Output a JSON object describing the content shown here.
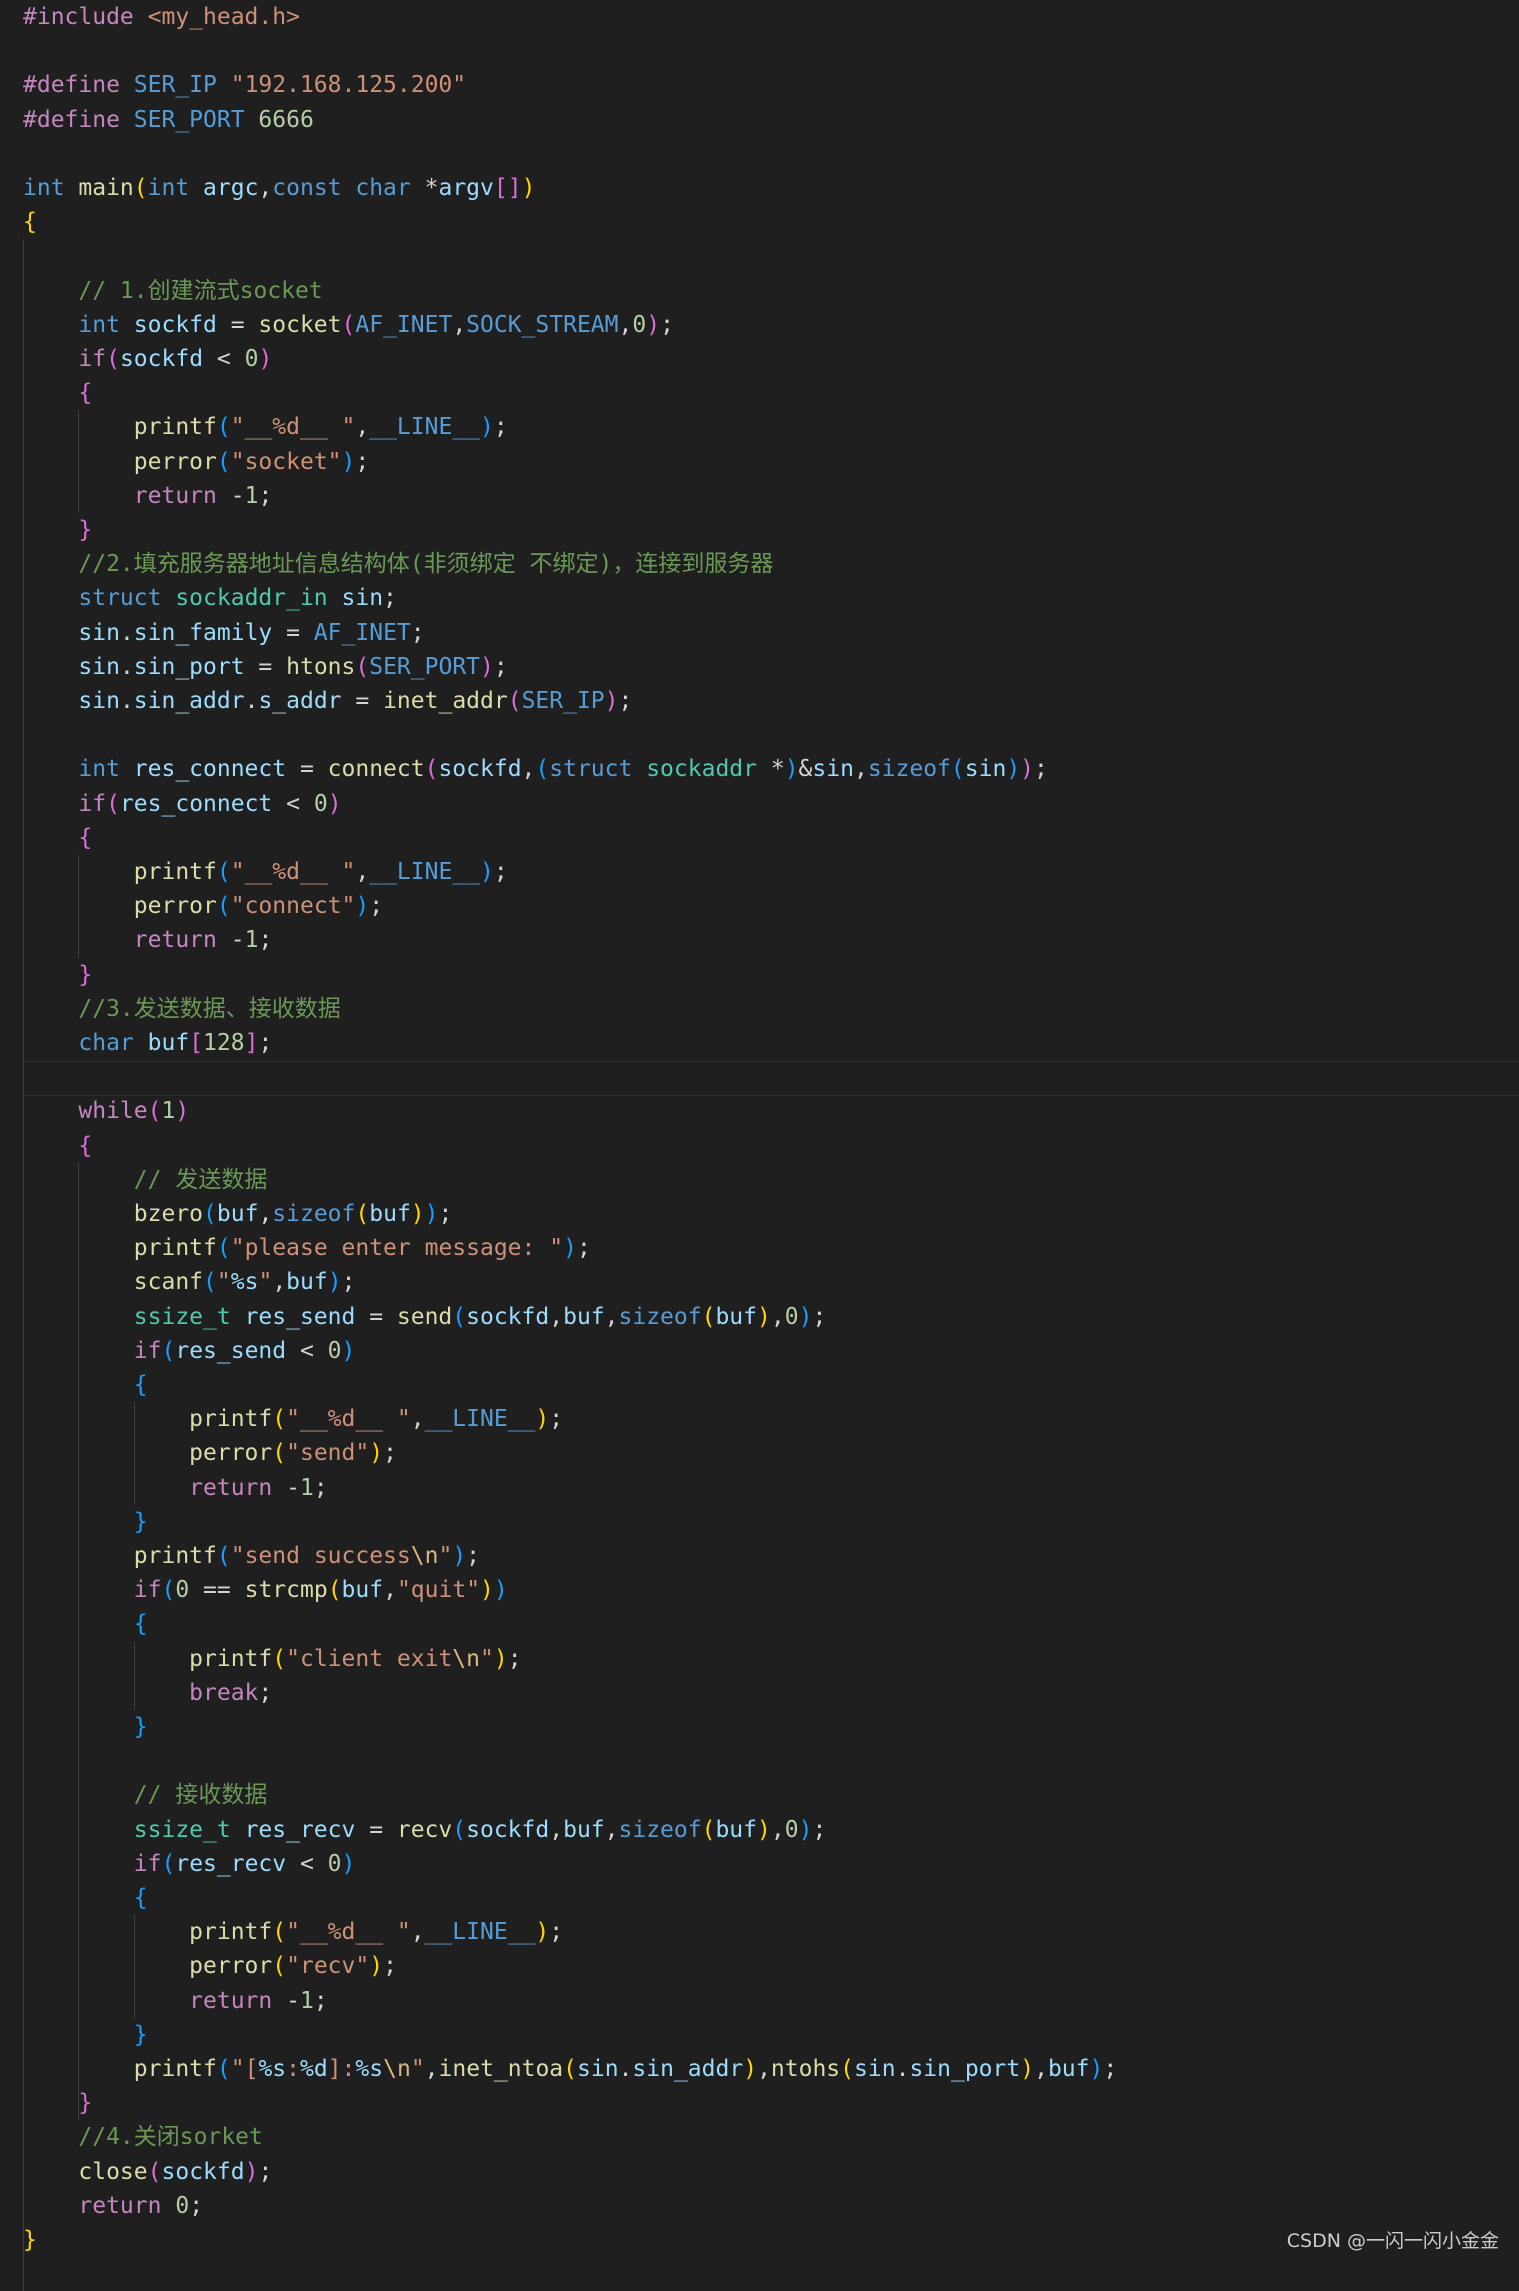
{
  "colors": {
    "background": "#1f1f1f",
    "keyword": "#569cd6",
    "control": "#c586c0",
    "function": "#dcdcaa",
    "variable": "#9cdcfe",
    "string": "#ce9178",
    "number": "#b5cea8",
    "comment": "#6a9955",
    "type": "#4ec9b0",
    "bracket_1": "#ffd700",
    "bracket_2": "#da70d6",
    "bracket_3": "#179fff"
  },
  "watermark": "CSDN @一闪一闪小金金",
  "code": [
    [
      [
        "pp",
        "#include "
      ],
      [
        "inc",
        "<my_head.h>"
      ]
    ],
    [],
    [
      [
        "pp",
        "#define "
      ],
      [
        "mac",
        "SER_IP "
      ],
      [
        "str",
        "\"192.168.125.200\""
      ]
    ],
    [
      [
        "pp",
        "#define "
      ],
      [
        "mac",
        "SER_PORT "
      ],
      [
        "num",
        "6666"
      ]
    ],
    [],
    [
      [
        "kw",
        "int "
      ],
      [
        "fn",
        "main"
      ],
      [
        "br1",
        "("
      ],
      [
        "kw",
        "int "
      ],
      [
        "var",
        "argc"
      ],
      [
        "txt",
        ","
      ],
      [
        "kw",
        "const char "
      ],
      [
        "txt",
        "*"
      ],
      [
        "var",
        "argv"
      ],
      [
        "br2",
        "[]"
      ],
      [
        "br1",
        ")"
      ]
    ],
    [
      [
        "br1",
        "{"
      ]
    ],
    [],
    [
      [
        "txt",
        "    "
      ],
      [
        "cmt",
        "// 1.创建流式socket"
      ]
    ],
    [
      [
        "txt",
        "    "
      ],
      [
        "kw",
        "int "
      ],
      [
        "var",
        "sockfd"
      ],
      [
        "txt",
        " = "
      ],
      [
        "fn",
        "socket"
      ],
      [
        "br2",
        "("
      ],
      [
        "mac",
        "AF_INET"
      ],
      [
        "txt",
        ","
      ],
      [
        "mac",
        "SOCK_STREAM"
      ],
      [
        "txt",
        ","
      ],
      [
        "num",
        "0"
      ],
      [
        "br2",
        ")"
      ],
      [
        "txt",
        ";"
      ]
    ],
    [
      [
        "txt",
        "    "
      ],
      [
        "ctl",
        "if"
      ],
      [
        "br2",
        "("
      ],
      [
        "var",
        "sockfd"
      ],
      [
        "txt",
        " < "
      ],
      [
        "num",
        "0"
      ],
      [
        "br2",
        ")"
      ]
    ],
    [
      [
        "txt",
        "    "
      ],
      [
        "br2",
        "{"
      ]
    ],
    [
      [
        "txt",
        "        "
      ],
      [
        "fn",
        "printf"
      ],
      [
        "br3",
        "("
      ],
      [
        "str",
        "\"__%d__ \""
      ],
      [
        "txt",
        ","
      ],
      [
        "mac",
        "__LINE__"
      ],
      [
        "br3",
        ")"
      ],
      [
        "txt",
        ";"
      ]
    ],
    [
      [
        "txt",
        "        "
      ],
      [
        "fn",
        "perror"
      ],
      [
        "br3",
        "("
      ],
      [
        "str",
        "\"socket\""
      ],
      [
        "br3",
        ")"
      ],
      [
        "txt",
        ";"
      ]
    ],
    [
      [
        "txt",
        "        "
      ],
      [
        "ctl",
        "return "
      ],
      [
        "txt",
        "-"
      ],
      [
        "num",
        "1"
      ],
      [
        "txt",
        ";"
      ]
    ],
    [
      [
        "txt",
        "    "
      ],
      [
        "br2",
        "}"
      ]
    ],
    [
      [
        "txt",
        "    "
      ],
      [
        "cmt",
        "//2.填充服务器地址信息结构体(非须绑定 不绑定)，连接到服务器"
      ]
    ],
    [
      [
        "txt",
        "    "
      ],
      [
        "kw",
        "struct "
      ],
      [
        "type",
        "sockaddr_in "
      ],
      [
        "var",
        "sin"
      ],
      [
        "txt",
        ";"
      ]
    ],
    [
      [
        "txt",
        "    "
      ],
      [
        "var",
        "sin"
      ],
      [
        "txt",
        "."
      ],
      [
        "var",
        "sin_family"
      ],
      [
        "txt",
        " = "
      ],
      [
        "mac",
        "AF_INET"
      ],
      [
        "txt",
        ";"
      ]
    ],
    [
      [
        "txt",
        "    "
      ],
      [
        "var",
        "sin"
      ],
      [
        "txt",
        "."
      ],
      [
        "var",
        "sin_port"
      ],
      [
        "txt",
        " = "
      ],
      [
        "fn",
        "htons"
      ],
      [
        "br2",
        "("
      ],
      [
        "mac",
        "SER_PORT"
      ],
      [
        "br2",
        ")"
      ],
      [
        "txt",
        ";"
      ]
    ],
    [
      [
        "txt",
        "    "
      ],
      [
        "var",
        "sin"
      ],
      [
        "txt",
        "."
      ],
      [
        "var",
        "sin_addr"
      ],
      [
        "txt",
        "."
      ],
      [
        "var",
        "s_addr"
      ],
      [
        "txt",
        " = "
      ],
      [
        "fn",
        "inet_addr"
      ],
      [
        "br2",
        "("
      ],
      [
        "mac",
        "SER_IP"
      ],
      [
        "br2",
        ")"
      ],
      [
        "txt",
        ";"
      ]
    ],
    [],
    [
      [
        "txt",
        "    "
      ],
      [
        "kw",
        "int "
      ],
      [
        "var",
        "res_connect"
      ],
      [
        "txt",
        " = "
      ],
      [
        "fn",
        "connect"
      ],
      [
        "br2",
        "("
      ],
      [
        "var",
        "sockfd"
      ],
      [
        "txt",
        ","
      ],
      [
        "br3",
        "("
      ],
      [
        "kw",
        "struct "
      ],
      [
        "type",
        "sockaddr "
      ],
      [
        "txt",
        "*"
      ],
      [
        "br3",
        ")"
      ],
      [
        "txt",
        "&"
      ],
      [
        "var",
        "sin"
      ],
      [
        "txt",
        ","
      ],
      [
        "kw",
        "sizeof"
      ],
      [
        "br3",
        "("
      ],
      [
        "var",
        "sin"
      ],
      [
        "br3",
        ")"
      ],
      [
        "br2",
        ")"
      ],
      [
        "txt",
        ";"
      ]
    ],
    [
      [
        "txt",
        "    "
      ],
      [
        "ctl",
        "if"
      ],
      [
        "br2",
        "("
      ],
      [
        "var",
        "res_connect"
      ],
      [
        "txt",
        " < "
      ],
      [
        "num",
        "0"
      ],
      [
        "br2",
        ")"
      ]
    ],
    [
      [
        "txt",
        "    "
      ],
      [
        "br2",
        "{"
      ]
    ],
    [
      [
        "txt",
        "        "
      ],
      [
        "fn",
        "printf"
      ],
      [
        "br3",
        "("
      ],
      [
        "str",
        "\"__%d__ \""
      ],
      [
        "txt",
        ","
      ],
      [
        "mac",
        "__LINE__"
      ],
      [
        "br3",
        ")"
      ],
      [
        "txt",
        ";"
      ]
    ],
    [
      [
        "txt",
        "        "
      ],
      [
        "fn",
        "perror"
      ],
      [
        "br3",
        "("
      ],
      [
        "str",
        "\"connect\""
      ],
      [
        "br3",
        ")"
      ],
      [
        "txt",
        ";"
      ]
    ],
    [
      [
        "txt",
        "        "
      ],
      [
        "ctl",
        "return "
      ],
      [
        "txt",
        "-"
      ],
      [
        "num",
        "1"
      ],
      [
        "txt",
        ";"
      ]
    ],
    [
      [
        "txt",
        "    "
      ],
      [
        "br2",
        "}"
      ]
    ],
    [
      [
        "txt",
        "    "
      ],
      [
        "cmt",
        "//3.发送数据、接收数据"
      ]
    ],
    [
      [
        "txt",
        "    "
      ],
      [
        "kw",
        "char "
      ],
      [
        "var",
        "buf"
      ],
      [
        "br2",
        "["
      ],
      [
        "num",
        "128"
      ],
      [
        "br2",
        "]"
      ],
      [
        "txt",
        ";"
      ]
    ],
    [],
    [
      [
        "txt",
        "    "
      ],
      [
        "ctl",
        "while"
      ],
      [
        "br2",
        "("
      ],
      [
        "num",
        "1"
      ],
      [
        "br2",
        ")"
      ]
    ],
    [
      [
        "txt",
        "    "
      ],
      [
        "br2",
        "{"
      ]
    ],
    [
      [
        "txt",
        "        "
      ],
      [
        "cmt",
        "// 发送数据"
      ]
    ],
    [
      [
        "txt",
        "        "
      ],
      [
        "fn",
        "bzero"
      ],
      [
        "br3",
        "("
      ],
      [
        "var",
        "buf"
      ],
      [
        "txt",
        ","
      ],
      [
        "kw",
        "sizeof"
      ],
      [
        "br1",
        "("
      ],
      [
        "var",
        "buf"
      ],
      [
        "br1",
        ")"
      ],
      [
        "br3",
        ")"
      ],
      [
        "txt",
        ";"
      ]
    ],
    [
      [
        "txt",
        "        "
      ],
      [
        "fn",
        "printf"
      ],
      [
        "br3",
        "("
      ],
      [
        "str",
        "\"please enter message: \""
      ],
      [
        "br3",
        ")"
      ],
      [
        "txt",
        ";"
      ]
    ],
    [
      [
        "txt",
        "        "
      ],
      [
        "fn",
        "scanf"
      ],
      [
        "br3",
        "("
      ],
      [
        "str",
        "\""
      ],
      [
        "var",
        "%s"
      ],
      [
        "str",
        "\""
      ],
      [
        "txt",
        ","
      ],
      [
        "var",
        "buf"
      ],
      [
        "br3",
        ")"
      ],
      [
        "txt",
        ";"
      ]
    ],
    [
      [
        "txt",
        "        "
      ],
      [
        "type",
        "ssize_t "
      ],
      [
        "var",
        "res_send"
      ],
      [
        "txt",
        " = "
      ],
      [
        "fn",
        "send"
      ],
      [
        "br3",
        "("
      ],
      [
        "var",
        "sockfd"
      ],
      [
        "txt",
        ","
      ],
      [
        "var",
        "buf"
      ],
      [
        "txt",
        ","
      ],
      [
        "kw",
        "sizeof"
      ],
      [
        "br1",
        "("
      ],
      [
        "var",
        "buf"
      ],
      [
        "br1",
        ")"
      ],
      [
        "txt",
        ","
      ],
      [
        "num",
        "0"
      ],
      [
        "br3",
        ")"
      ],
      [
        "txt",
        ";"
      ]
    ],
    [
      [
        "txt",
        "        "
      ],
      [
        "ctl",
        "if"
      ],
      [
        "br3",
        "("
      ],
      [
        "var",
        "res_send"
      ],
      [
        "txt",
        " < "
      ],
      [
        "num",
        "0"
      ],
      [
        "br3",
        ")"
      ]
    ],
    [
      [
        "txt",
        "        "
      ],
      [
        "br3",
        "{"
      ]
    ],
    [
      [
        "txt",
        "            "
      ],
      [
        "fn",
        "printf"
      ],
      [
        "br1",
        "("
      ],
      [
        "str",
        "\"__%d__ \""
      ],
      [
        "txt",
        ","
      ],
      [
        "mac",
        "__LINE__"
      ],
      [
        "br1",
        ")"
      ],
      [
        "txt",
        ";"
      ]
    ],
    [
      [
        "txt",
        "            "
      ],
      [
        "fn",
        "perror"
      ],
      [
        "br1",
        "("
      ],
      [
        "str",
        "\"send\""
      ],
      [
        "br1",
        ")"
      ],
      [
        "txt",
        ";"
      ]
    ],
    [
      [
        "txt",
        "            "
      ],
      [
        "ctl",
        "return "
      ],
      [
        "txt",
        "-"
      ],
      [
        "num",
        "1"
      ],
      [
        "txt",
        ";"
      ]
    ],
    [
      [
        "txt",
        "        "
      ],
      [
        "br3",
        "}"
      ]
    ],
    [
      [
        "txt",
        "        "
      ],
      [
        "fn",
        "printf"
      ],
      [
        "br3",
        "("
      ],
      [
        "str",
        "\"send success"
      ],
      [
        "esc",
        "\\n"
      ],
      [
        "str",
        "\""
      ],
      [
        "br3",
        ")"
      ],
      [
        "txt",
        ";"
      ]
    ],
    [
      [
        "txt",
        "        "
      ],
      [
        "ctl",
        "if"
      ],
      [
        "br3",
        "("
      ],
      [
        "num",
        "0"
      ],
      [
        "txt",
        " == "
      ],
      [
        "fn",
        "strcmp"
      ],
      [
        "br1",
        "("
      ],
      [
        "var",
        "buf"
      ],
      [
        "txt",
        ","
      ],
      [
        "str",
        "\"quit\""
      ],
      [
        "br1",
        ")"
      ],
      [
        "br3",
        ")"
      ]
    ],
    [
      [
        "txt",
        "        "
      ],
      [
        "br3",
        "{"
      ]
    ],
    [
      [
        "txt",
        "            "
      ],
      [
        "fn",
        "printf"
      ],
      [
        "br1",
        "("
      ],
      [
        "str",
        "\"client exit"
      ],
      [
        "esc",
        "\\n"
      ],
      [
        "str",
        "\""
      ],
      [
        "br1",
        ")"
      ],
      [
        "txt",
        ";"
      ]
    ],
    [
      [
        "txt",
        "            "
      ],
      [
        "ctl",
        "break"
      ],
      [
        "txt",
        ";"
      ]
    ],
    [
      [
        "txt",
        "        "
      ],
      [
        "br3",
        "}"
      ]
    ],
    [],
    [
      [
        "txt",
        "        "
      ],
      [
        "cmt",
        "// 接收数据"
      ]
    ],
    [
      [
        "txt",
        "        "
      ],
      [
        "type",
        "ssize_t "
      ],
      [
        "var",
        "res_recv"
      ],
      [
        "txt",
        " = "
      ],
      [
        "fn",
        "recv"
      ],
      [
        "br3",
        "("
      ],
      [
        "var",
        "sockfd"
      ],
      [
        "txt",
        ","
      ],
      [
        "var",
        "buf"
      ],
      [
        "txt",
        ","
      ],
      [
        "kw",
        "sizeof"
      ],
      [
        "br1",
        "("
      ],
      [
        "var",
        "buf"
      ],
      [
        "br1",
        ")"
      ],
      [
        "txt",
        ","
      ],
      [
        "num",
        "0"
      ],
      [
        "br3",
        ")"
      ],
      [
        "txt",
        ";"
      ]
    ],
    [
      [
        "txt",
        "        "
      ],
      [
        "ctl",
        "if"
      ],
      [
        "br3",
        "("
      ],
      [
        "var",
        "res_recv"
      ],
      [
        "txt",
        " < "
      ],
      [
        "num",
        "0"
      ],
      [
        "br3",
        ")"
      ]
    ],
    [
      [
        "txt",
        "        "
      ],
      [
        "br3",
        "{"
      ]
    ],
    [
      [
        "txt",
        "            "
      ],
      [
        "fn",
        "printf"
      ],
      [
        "br1",
        "("
      ],
      [
        "str",
        "\"__%d__ \""
      ],
      [
        "txt",
        ","
      ],
      [
        "mac",
        "__LINE__"
      ],
      [
        "br1",
        ")"
      ],
      [
        "txt",
        ";"
      ]
    ],
    [
      [
        "txt",
        "            "
      ],
      [
        "fn",
        "perror"
      ],
      [
        "br1",
        "("
      ],
      [
        "str",
        "\"recv\""
      ],
      [
        "br1",
        ")"
      ],
      [
        "txt",
        ";"
      ]
    ],
    [
      [
        "txt",
        "            "
      ],
      [
        "ctl",
        "return "
      ],
      [
        "txt",
        "-"
      ],
      [
        "num",
        "1"
      ],
      [
        "txt",
        ";"
      ]
    ],
    [
      [
        "txt",
        "        "
      ],
      [
        "br3",
        "}"
      ]
    ],
    [
      [
        "txt",
        "        "
      ],
      [
        "fn",
        "printf"
      ],
      [
        "br3",
        "("
      ],
      [
        "str",
        "\"["
      ],
      [
        "var",
        "%s"
      ],
      [
        "str",
        ":"
      ],
      [
        "var",
        "%d"
      ],
      [
        "str",
        "]:"
      ],
      [
        "var",
        "%s"
      ],
      [
        "esc",
        "\\n"
      ],
      [
        "str",
        "\""
      ],
      [
        "txt",
        ","
      ],
      [
        "fn",
        "inet_ntoa"
      ],
      [
        "br1",
        "("
      ],
      [
        "var",
        "sin"
      ],
      [
        "txt",
        "."
      ],
      [
        "var",
        "sin_addr"
      ],
      [
        "br1",
        ")"
      ],
      [
        "txt",
        ","
      ],
      [
        "fn",
        "ntohs"
      ],
      [
        "br1",
        "("
      ],
      [
        "var",
        "sin"
      ],
      [
        "txt",
        "."
      ],
      [
        "var",
        "sin_port"
      ],
      [
        "br1",
        ")"
      ],
      [
        "txt",
        ","
      ],
      [
        "var",
        "buf"
      ],
      [
        "br3",
        ")"
      ],
      [
        "txt",
        ";"
      ]
    ],
    [
      [
        "txt",
        "    "
      ],
      [
        "br2",
        "}"
      ]
    ],
    [
      [
        "txt",
        "    "
      ],
      [
        "cmt",
        "//4.关闭sorket"
      ]
    ],
    [
      [
        "txt",
        "    "
      ],
      [
        "fn",
        "close"
      ],
      [
        "br2",
        "("
      ],
      [
        "var",
        "sockfd"
      ],
      [
        "br2",
        ")"
      ],
      [
        "txt",
        ";"
      ]
    ],
    [
      [
        "txt",
        "    "
      ],
      [
        "ctl",
        "return "
      ],
      [
        "num",
        "0"
      ],
      [
        "txt",
        ";"
      ]
    ],
    [
      [
        "br1",
        "}"
      ]
    ]
  ]
}
